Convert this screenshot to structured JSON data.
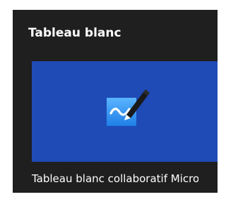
{
  "section": {
    "title": "Tableau blanc"
  },
  "app": {
    "name": "Tableau blanc collaboratif Microsoft Whiteboard",
    "icon": "whiteboard-pen-icon",
    "tile_color": "#1f4bb6",
    "icon_colors": {
      "board_top": "#5ab4ff",
      "board_bottom": "#1f7fe6",
      "pen": "#1a1a1a",
      "stroke": "#ffffff"
    }
  }
}
